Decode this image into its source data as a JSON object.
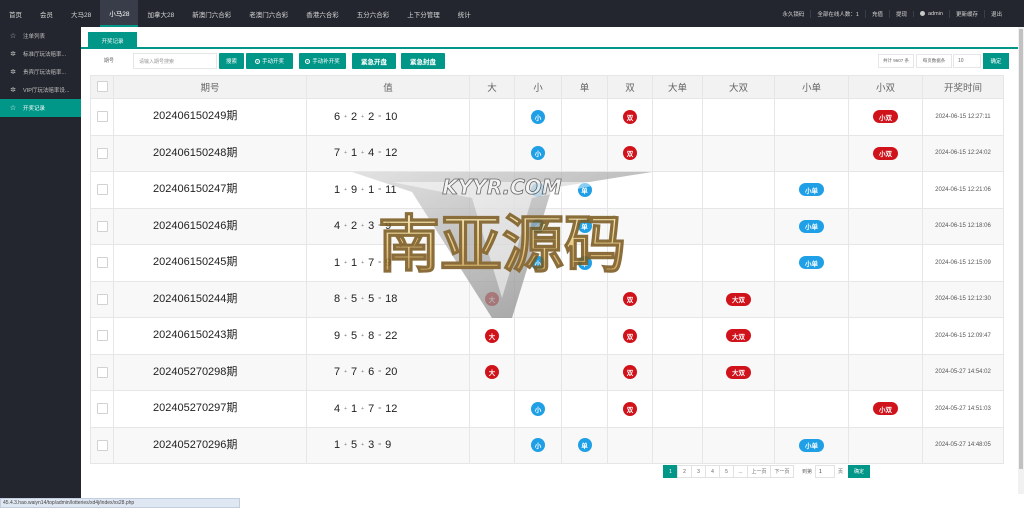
{
  "topnav": {
    "items": [
      "首页",
      "会员",
      "大马28",
      "小马28",
      "加拿大28",
      "新澳门六合彩",
      "老澳门六合彩",
      "香港六合彩",
      "五分六合彩",
      "上下分管理",
      "统计"
    ],
    "active": "小马28"
  },
  "topright": {
    "lock": "永久锁码",
    "online": "全部在线人数：1",
    "recharge": "充值",
    "withdraw": "提现",
    "user": "admin",
    "cache": "更新缓存",
    "logout": "退出"
  },
  "sidebar": {
    "items": [
      {
        "label": "注单列表",
        "icon": "star-icon"
      },
      {
        "label": "标准厅玩法赔率...",
        "icon": "gear-icon"
      },
      {
        "label": "贵宾厅玩法赔率...",
        "icon": "gear-icon"
      },
      {
        "label": "VIP厅玩法赔率设...",
        "icon": "gear-icon"
      },
      {
        "label": "开奖记录",
        "icon": "star-icon"
      }
    ],
    "active_index": 4
  },
  "tab": {
    "label": "开奖记录"
  },
  "toolbar": {
    "period_label": "期号",
    "search_placeholder": "请输入期号搜索",
    "search_button": "搜索",
    "manual_open": "手动开奖",
    "manual_open_all": "手动补开奖",
    "emergency_open": "紧急开盘",
    "emergency_close": "紧急封盘",
    "total": "共计 9607 条",
    "per_page_label": "每页数据条",
    "per_page_value": "10",
    "ok": "确定"
  },
  "table": {
    "headers": [
      "",
      "期号",
      "值",
      "大",
      "小",
      "单",
      "双",
      "大单",
      "大双",
      "小单",
      "小双",
      "开奖时间"
    ],
    "rows": [
      {
        "period": "202406150249期",
        "nums": [
          "6",
          "2",
          "2",
          "10"
        ],
        "big": "",
        "small": "小",
        "single": "",
        "double": "双",
        "big_single": "",
        "big_double": "",
        "small_single": "",
        "small_double": "小双",
        "time": "2024-06-15 12:27:11"
      },
      {
        "period": "202406150248期",
        "nums": [
          "7",
          "1",
          "4",
          "12"
        ],
        "big": "",
        "small": "小",
        "single": "",
        "double": "双",
        "big_single": "",
        "big_double": "",
        "small_single": "",
        "small_double": "小双",
        "time": "2024-06-15 12:24:02"
      },
      {
        "period": "202406150247期",
        "nums": [
          "1",
          "9",
          "1",
          "11"
        ],
        "big": "",
        "small": "小",
        "single": "单",
        "double": "",
        "big_single": "",
        "big_double": "",
        "small_single": "小单",
        "small_double": "",
        "time": "2024-06-15 12:21:06"
      },
      {
        "period": "202406150246期",
        "nums": [
          "4",
          "2",
          "3",
          "9"
        ],
        "big": "",
        "small": "小",
        "single": "单",
        "double": "",
        "big_single": "",
        "big_double": "",
        "small_single": "小单",
        "small_double": "",
        "time": "2024-06-15 12:18:06"
      },
      {
        "period": "202406150245期",
        "nums": [
          "1",
          "1",
          "7",
          "9"
        ],
        "big": "",
        "small": "小",
        "single": "单",
        "double": "",
        "big_single": "",
        "big_double": "",
        "small_single": "小单",
        "small_double": "",
        "time": "2024-06-15 12:15:09"
      },
      {
        "period": "202406150244期",
        "nums": [
          "8",
          "5",
          "5",
          "18"
        ],
        "big": "大",
        "small": "",
        "single": "",
        "double": "双",
        "big_single": "",
        "big_double": "大双",
        "small_single": "",
        "small_double": "",
        "time": "2024-06-15 12:12:30"
      },
      {
        "period": "202406150243期",
        "nums": [
          "9",
          "5",
          "8",
          "22"
        ],
        "big": "大",
        "small": "",
        "single": "",
        "double": "双",
        "big_single": "",
        "big_double": "大双",
        "small_single": "",
        "small_double": "",
        "time": "2024-06-15 12:09:47"
      },
      {
        "period": "202405270298期",
        "nums": [
          "7",
          "7",
          "6",
          "20"
        ],
        "big": "大",
        "small": "",
        "single": "",
        "double": "双",
        "big_single": "",
        "big_double": "大双",
        "small_single": "",
        "small_double": "",
        "time": "2024-05-27 14:54:02"
      },
      {
        "period": "202405270297期",
        "nums": [
          "4",
          "1",
          "7",
          "12"
        ],
        "big": "",
        "small": "小",
        "single": "",
        "double": "双",
        "big_single": "",
        "big_double": "",
        "small_single": "",
        "small_double": "小双",
        "time": "2024-05-27 14:51:03"
      },
      {
        "period": "202405270296期",
        "nums": [
          "1",
          "5",
          "3",
          "9"
        ],
        "big": "",
        "small": "小",
        "single": "单",
        "double": "",
        "big_single": "",
        "big_double": "",
        "small_single": "小单",
        "small_double": "",
        "time": "2024-05-27 14:48:05"
      }
    ]
  },
  "pager": {
    "pages": [
      "1",
      "2",
      "3",
      "4",
      "5",
      "...",
      "上一页",
      "下一页"
    ],
    "current": "1",
    "goto_label": "到第",
    "goto_value": "1",
    "unit": "页",
    "ok": "确定"
  },
  "statusbar": {
    "url": "45.4.3.hao.waiyn14/top/admin/lotteries/xd4j/index/xs28.php"
  },
  "watermark": {
    "top_text": "KYYR.COM",
    "main_text": "南亚源码"
  },
  "colors": {
    "accent": "#009688",
    "nav_bg": "#23262e",
    "badge_blue": "#1e9fe6",
    "badge_red": "#d0121b"
  }
}
